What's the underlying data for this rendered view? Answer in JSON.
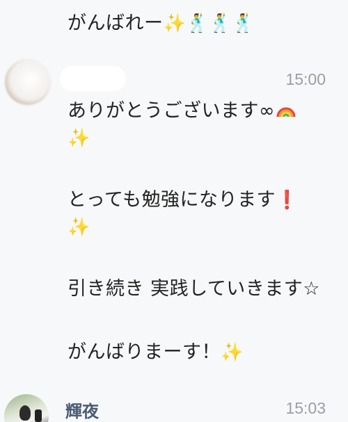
{
  "messages_top": {
    "cheer_text": "がんばれー",
    "cheer_emoji_sparkles": "✨",
    "cheer_emoji_dancers": "🕺🕺🕺"
  },
  "message_1": {
    "time": "15:00",
    "line1_text": "ありがとうございます∞",
    "line2_emoji": "✨",
    "line3_text": "とっても勉強になります",
    "line3_emoji": "❗",
    "line4_emoji": "✨",
    "line5_text": "引き続き 実践していきます☆",
    "line6_text": "がんばりまーす！",
    "line6_emoji": "✨"
  },
  "message_2": {
    "sender_name": "輝夜",
    "time": "15:03"
  },
  "colors": {
    "background": "#f7f8fa",
    "time_gray": "#9a9ea5",
    "name_blue": "#4a5b73"
  }
}
